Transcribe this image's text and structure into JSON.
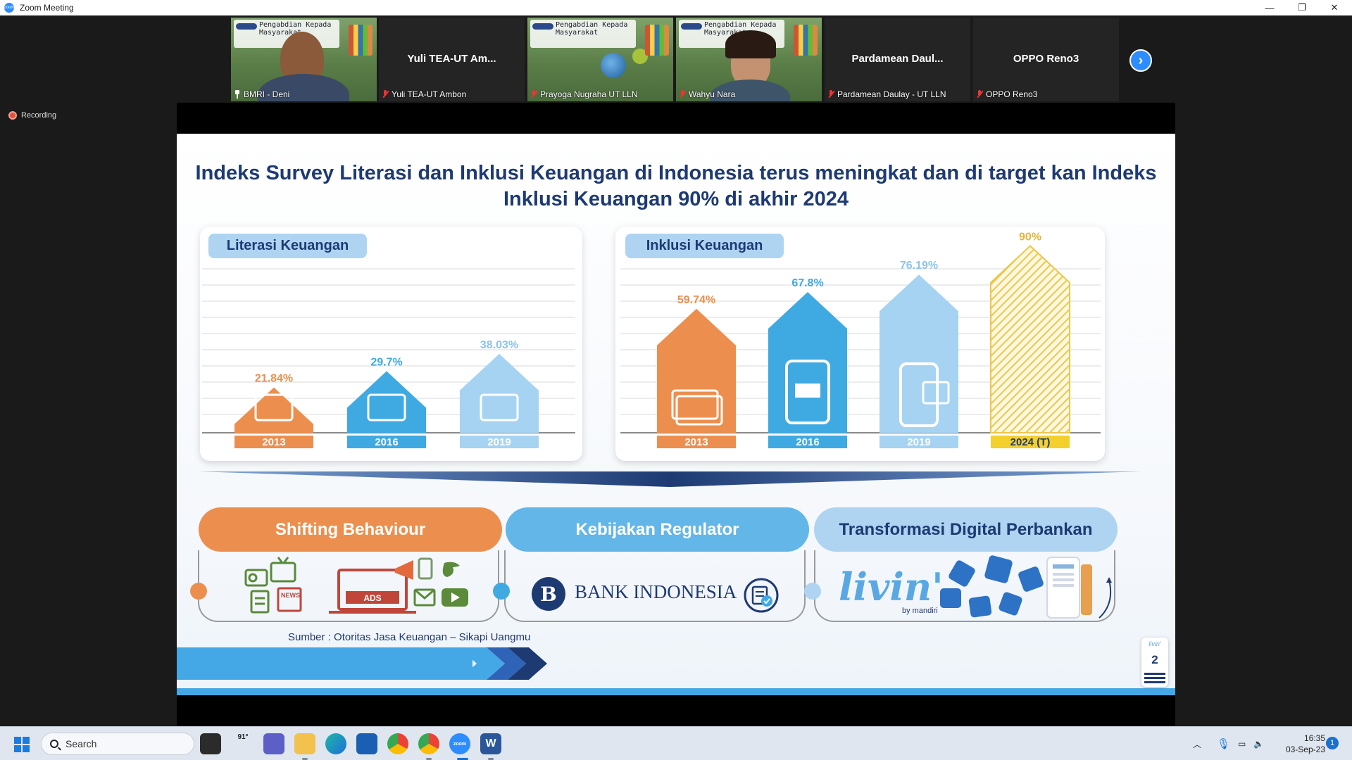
{
  "window": {
    "title": "Zoom Meeting",
    "minimize": "—",
    "maximize": "❐",
    "close": "✕"
  },
  "participants": [
    {
      "name": "BMRI - Deni",
      "has_video": true,
      "muted": false,
      "pinned": true,
      "banner": "Pengabdian Kepada Masyarakat"
    },
    {
      "name": "Yuli TEA-UT Ambon",
      "display": "Yuli TEA-UT Am...",
      "has_video": false,
      "muted": true
    },
    {
      "name": "Prayoga Nugraha UT LLN",
      "has_video": true,
      "muted": true,
      "banner": "Pengabdian Kepada Masyarakat"
    },
    {
      "name": "Wahyu Nara",
      "has_video": true,
      "muted": true,
      "banner": "Pengabdian Kepada Masyarakat"
    },
    {
      "name": "Pardamean Daulay - UT LLN",
      "display": "Pardamean  Daul...",
      "has_video": false,
      "muted": true
    },
    {
      "name": "OPPO Reno3",
      "display": "OPPO Reno3",
      "has_video": false,
      "muted": true
    }
  ],
  "recording": {
    "label": "Recording"
  },
  "slide": {
    "title_line1": "Indeks Survey Literasi dan Inklusi Keuangan di Indonesia terus meningkat dan di target kan Indeks",
    "title_line2": "Inklusi Keuangan 90% di akhir 2024",
    "literasi": {
      "label": "Literasi Keuangan"
    },
    "inklusi": {
      "label": "Inklusi Keuangan"
    },
    "sections": {
      "shifting": "Shifting Behaviour",
      "kebijakan": "Kebijakan Regulator",
      "transformasi": "Transformasi Digital Perbankan"
    },
    "ads_label": "ADS",
    "news_label": "NEWS",
    "bank_indonesia": "BANK INDONESIA",
    "livin": "livin'",
    "by_mandiri": "by mandiri",
    "source": "Sumber : Otoritas Jasa Keuangan – Sikapi Uangmu",
    "page_number": "2",
    "page_logo": "livin'"
  },
  "chart_data": [
    {
      "type": "bar",
      "title": "Literasi Keuangan",
      "categories": [
        "2013",
        "2016",
        "2019"
      ],
      "values": [
        21.84,
        29.7,
        38.03
      ],
      "value_labels": [
        "21.84%",
        "29.7%",
        "38.03%"
      ],
      "colors": [
        "#ec8f4e",
        "#3fa9e2",
        "#a6d3f2"
      ],
      "ylim": [
        0,
        100
      ],
      "grid": true
    },
    {
      "type": "bar",
      "title": "Inklusi Keuangan",
      "categories": [
        "2013",
        "2016",
        "2019",
        "2024 (T)"
      ],
      "values": [
        59.74,
        67.8,
        76.19,
        90
      ],
      "value_labels": [
        "59.74%",
        "67.8%",
        "76.19%",
        "90%"
      ],
      "colors": [
        "#ec8f4e",
        "#3fa9e2",
        "#a6d3f2",
        "#f3d46b"
      ],
      "ylim": [
        0,
        100
      ],
      "grid": true
    }
  ],
  "taskbar": {
    "search_placeholder": "Search",
    "weather": "91°",
    "time": "16:35",
    "date": "03-Sep-23",
    "notifications": "1"
  },
  "colors": {
    "accent": "#2d8cff",
    "orange": "#ec8f4e",
    "blue": "#3fa9e2",
    "light_blue": "#a6d3f2",
    "yellow": "#f3d46b",
    "navy": "#1e3a73"
  }
}
